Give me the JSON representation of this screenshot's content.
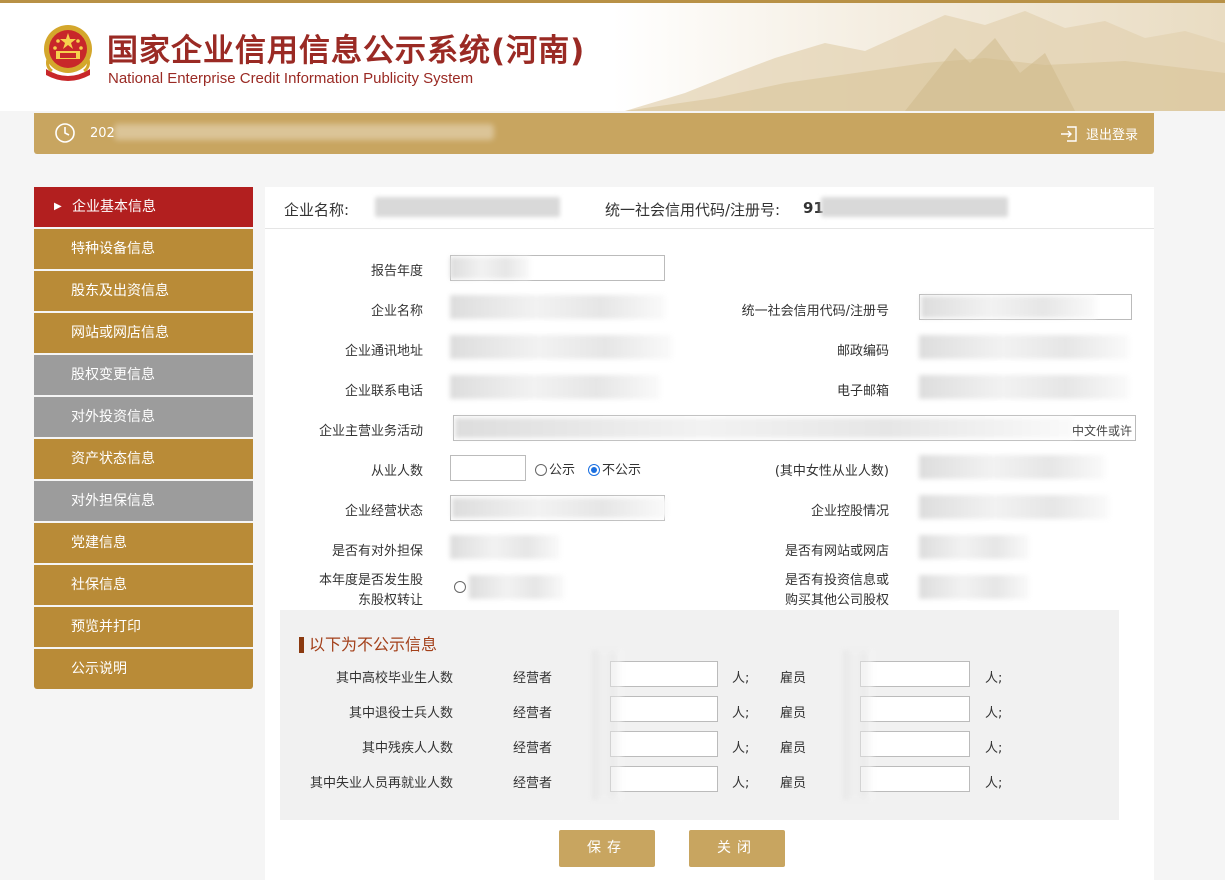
{
  "header": {
    "title_cn": "国家企业信用信息公示系统(河南)",
    "title_en": "National Enterprise Credit Information Publicity System"
  },
  "topbar": {
    "date_prefix": "202",
    "logout_label": "退出登录"
  },
  "sidebar": {
    "items": [
      {
        "label": "企业基本信息",
        "state": "active"
      },
      {
        "label": "特种设备信息",
        "state": "normal"
      },
      {
        "label": "股东及出资信息",
        "state": "normal"
      },
      {
        "label": "网站或网店信息",
        "state": "normal"
      },
      {
        "label": "股权变更信息",
        "state": "disabled"
      },
      {
        "label": "对外投资信息",
        "state": "disabled"
      },
      {
        "label": "资产状态信息",
        "state": "normal"
      },
      {
        "label": "对外担保信息",
        "state": "disabled"
      },
      {
        "label": "党建信息",
        "state": "normal"
      },
      {
        "label": "社保信息",
        "state": "normal"
      },
      {
        "label": "预览并打印",
        "state": "normal"
      },
      {
        "label": "公示说明",
        "state": "normal"
      }
    ]
  },
  "enterprise_head": {
    "name_label": "企业名称:",
    "code_label": "统一社会信用代码/注册号:",
    "code_prefix": "91"
  },
  "form": {
    "report_year": "报告年度",
    "ent_name": "企业名称",
    "credit_code": "统一社会信用代码/注册号",
    "address": "企业通讯地址",
    "postcode": "邮政编码",
    "phone": "企业联系电话",
    "email": "电子邮箱",
    "business": "企业主营业务活动",
    "business_tail": "中文件或许",
    "employees": "从业人数",
    "public_label": "公示",
    "private_label": "不公示",
    "female_employees": "(其中女性从业人数)",
    "status": "企业经营状态",
    "holding": "企业控股情况",
    "guarantee": "是否有对外担保",
    "website": "是否有网站或网店",
    "equity_transfer_1": "本年度是否发生股",
    "equity_transfer_2": "东股权转让",
    "investment_1": "是否有投资信息或",
    "investment_2": "购买其他公司股权"
  },
  "private_section": {
    "title": "以下为不公示信息",
    "operator_label": "经营者",
    "employee_label": "雇员",
    "unit": "人;",
    "rows": [
      "其中高校毕业生人数",
      "其中退役士兵人数",
      "其中残疾人人数",
      "其中失业人员再就业人数"
    ]
  },
  "buttons": {
    "save": "保存",
    "close": "关闭"
  },
  "colors": {
    "brand_gold": "#c8a560",
    "sidebar_gold": "#b98b37",
    "sidebar_active": "#b21f1f",
    "sidebar_disabled": "#9c9c9c",
    "title_red": "#9a2a24"
  }
}
